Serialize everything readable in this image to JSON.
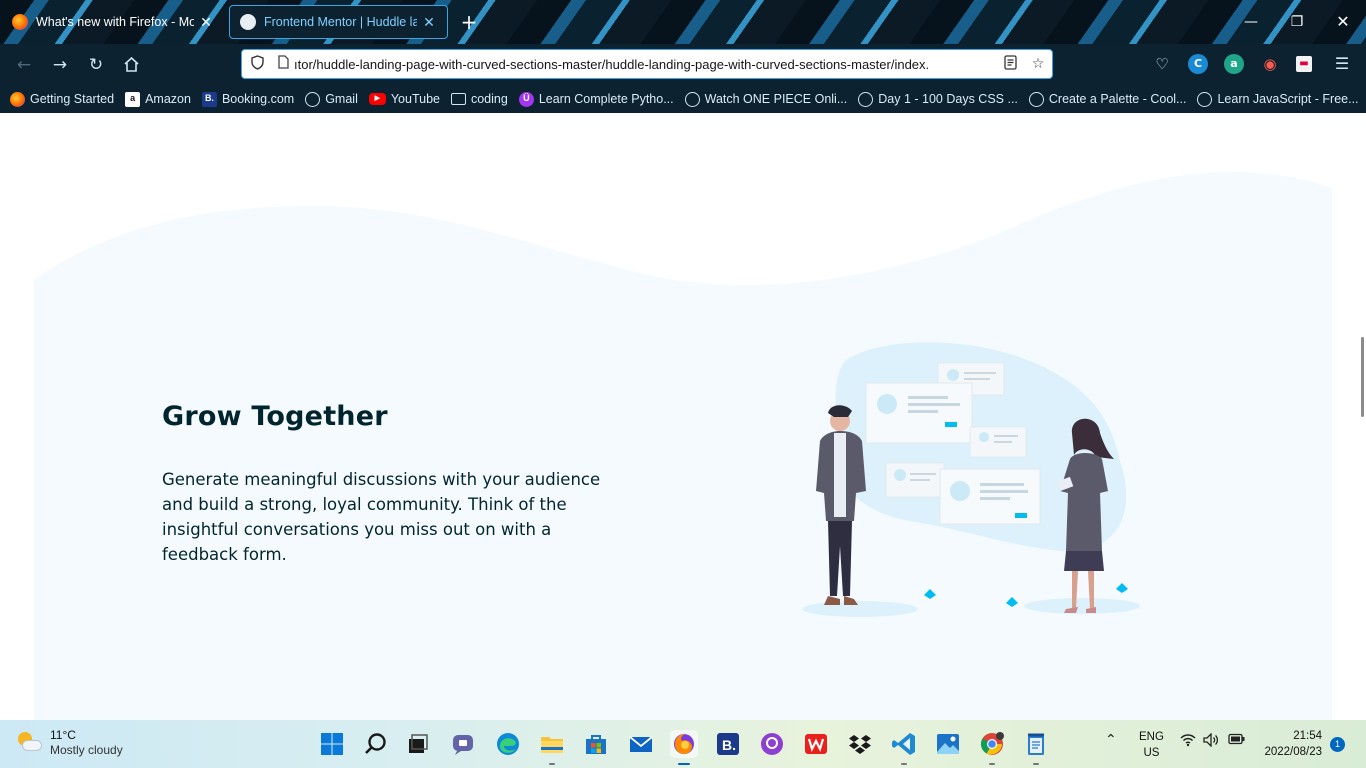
{
  "browser": {
    "tabs": [
      {
        "title": "What's new with Firefox - More",
        "active": false
      },
      {
        "title": "Frontend Mentor | Huddle landi",
        "active": true
      }
    ],
    "new_tab_label": "+",
    "window_controls": {
      "minimize": "—",
      "maximize": "❐",
      "close": "✕"
    },
    "url": "ıtor/huddle-landing-page-with-curved-sections-master/huddle-landing-page-with-curved-sections-master/index.",
    "bookmarks": [
      {
        "label": "Getting Started",
        "icon": "firefox-icon"
      },
      {
        "label": "Amazon",
        "icon": "amazon-icon"
      },
      {
        "label": "Booking.com",
        "icon": "booking-icon"
      },
      {
        "label": "Gmail",
        "icon": "globe-icon"
      },
      {
        "label": "YouTube",
        "icon": "youtube-icon"
      },
      {
        "label": "coding",
        "icon": "folder-icon"
      },
      {
        "label": "Learn Complete Pytho...",
        "icon": "udemy-icon"
      },
      {
        "label": "Watch ONE PIECE Onli...",
        "icon": "globe-icon"
      },
      {
        "label": "Day 1 - 100 Days CSS ...",
        "icon": "globe-icon"
      },
      {
        "label": "Create a Palette - Cool...",
        "icon": "globe-icon"
      },
      {
        "label": "Learn JavaScript - Free...",
        "icon": "globe-icon"
      }
    ]
  },
  "page": {
    "heading": "Grow Together",
    "body": "Generate meaningful discussions with your audience and build a strong, loyal community. Think of the insightful conversations you miss out on with a feedback form.",
    "colors": {
      "section_bg": "#f5faff",
      "blob": "#dcf1fb",
      "accent": "#00bcf0",
      "text": "#00252e"
    }
  },
  "taskbar": {
    "weather": {
      "temp": "11°C",
      "condition": "Mostly cloudy"
    },
    "apps": [
      "windows-start-icon",
      "search-icon",
      "task-view-icon",
      "teams-chat-icon",
      "edge-icon",
      "file-explorer-icon",
      "microsoft-store-icon",
      "mail-icon",
      "firefox-icon",
      "booking-app-icon",
      "github-desktop-icon",
      "wps-office-icon",
      "dropbox-icon",
      "vscode-icon",
      "photos-icon",
      "chrome-icon",
      "notepad-icon"
    ],
    "lang_line1": "ENG",
    "lang_line2": "US",
    "time": "21:54",
    "date": "2022/08/23",
    "notification_count": "1"
  }
}
